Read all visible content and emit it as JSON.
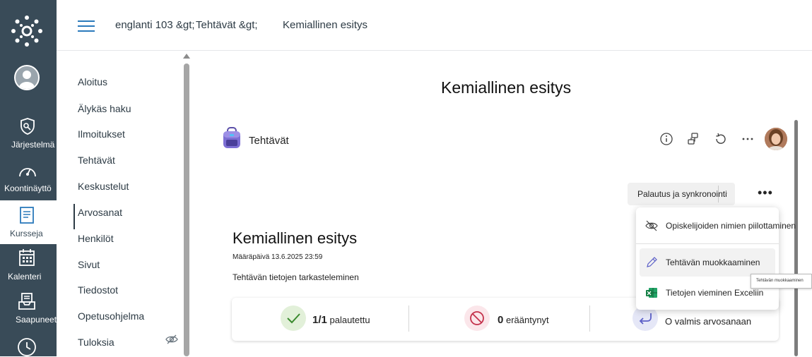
{
  "global_nav": {
    "items": [
      {
        "label": "Järjestelmä",
        "icon": "shield-icon"
      },
      {
        "label": "Koontinäyttö",
        "icon": "dashboard-icon"
      },
      {
        "label": "Kursseja",
        "icon": "book-icon"
      },
      {
        "label": "Kalenteri",
        "icon": "calendar-icon"
      },
      {
        "label": "Saapuneet",
        "icon": "inbox-icon"
      },
      {
        "label": "",
        "icon": "clock-icon"
      }
    ]
  },
  "breadcrumb": {
    "course": "englanti 103 &gt;",
    "section": "Tehtävät &gt;",
    "current": "Kemiallinen esitys"
  },
  "course_nav": {
    "items": [
      "Aloitus",
      "Älykäs haku",
      "Ilmoitukset",
      "Tehtävät",
      "Keskustelut",
      "Arvosanat",
      "Henkilöt",
      "Sivut",
      "Tiedostot",
      "Opetusohjelma",
      "Tuloksia"
    ]
  },
  "page": {
    "title": "Kemiallinen esitys"
  },
  "app": {
    "name": "Tehtävät",
    "sync_button": "Palautus ja synkronointi",
    "more": "•••"
  },
  "assignment": {
    "title": "Kemiallinen esitys",
    "due": "Määräpäivä 13.6.2025 23:59",
    "details_link": "Tehtävän tietojen tarkasteleminen"
  },
  "stats": {
    "returned_count": "1/1",
    "returned_label": "palautettu",
    "overdue_count": "0",
    "overdue_label": "erääntynyt",
    "ready_label": "O valmis arvosanaan"
  },
  "menu": {
    "items": [
      {
        "label": "Opiskelijoiden nimien piilottaminen",
        "icon": "eye-off-icon"
      },
      {
        "label": "Tehtävän muokkaaminen",
        "icon": "pencil-icon"
      },
      {
        "label": "Tietojen vieminen Exceliin",
        "icon": "excel-icon"
      }
    ],
    "tooltip": "Tehtävän muokkaaminen"
  },
  "colors": {
    "nav_bg": "#394b58",
    "accent": "#2b7abc",
    "success_bg": "#e2f0d9",
    "danger_bg": "#fbe6ea",
    "info_bg": "#e5e7f7"
  }
}
